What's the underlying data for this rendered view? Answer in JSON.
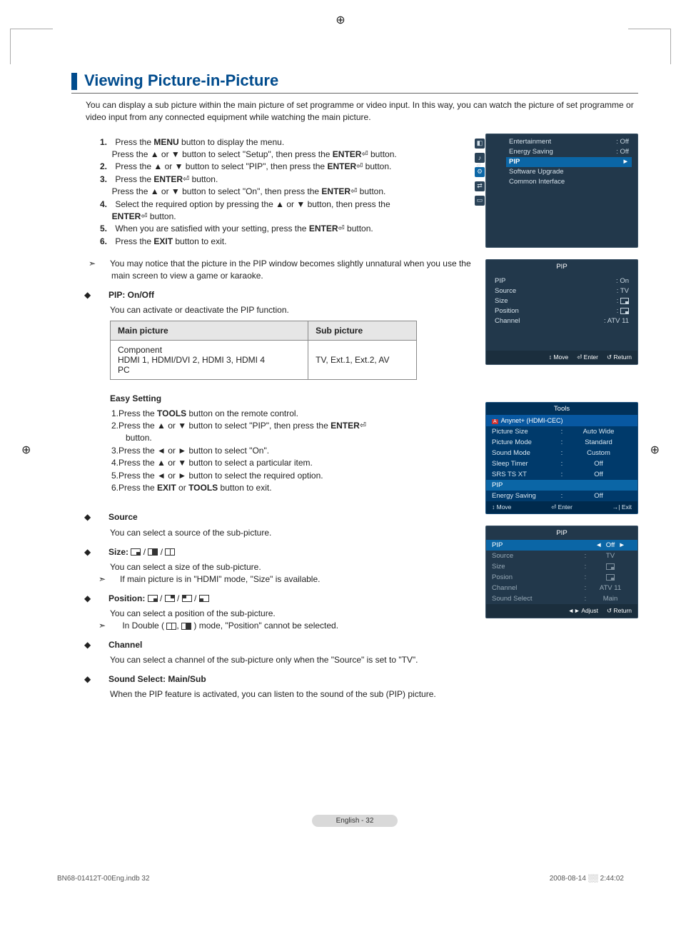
{
  "page": {
    "title": "Viewing Picture-in-Picture",
    "intro": "You can display a sub picture within the main picture of set programme or video input. In this way, you can watch the picture of set programme or video input from any connected equipment while watching the main picture.",
    "page_label": "English - 32",
    "footer_left": "BN68-01412T-00Eng.indb   32",
    "footer_right": "2008-08-14   ░░ 2:44:02"
  },
  "steps": {
    "s1_a": "Press the ",
    "s1_b": "MENU",
    "s1_c": " button to display the menu.",
    "s1_d": "Press the ▲ or ▼ button to select \"Setup\", then press the ",
    "s1_e": "ENTER",
    "s1_f": " button.",
    "s2_a": "Press the ▲ or ▼ button to select \"PIP\", then press the ",
    "s2_b": "ENTER",
    "s2_c": " button.",
    "s3_a": "Press the ",
    "s3_b": "ENTER",
    "s3_c": " button.",
    "s3_d": "Press the ▲ or ▼ button to select \"On\", then press the ",
    "s3_e": "ENTER",
    "s3_f": " button.",
    "s4_a": "Select the required option by pressing the ▲ or ▼ button, then press the ",
    "s4_b": "ENTER",
    "s4_c": " button.",
    "s5_a": "When you are satisfied with your setting, press the ",
    "s5_b": "ENTER",
    "s5_c": " button.",
    "s6_a": "Press the ",
    "s6_b": "EXIT",
    "s6_c": " button to exit.",
    "note": "You may notice that the picture in the PIP window becomes slightly unnatural when you use the main screen to view a game or karaoke."
  },
  "pip_onoff": {
    "label": "PIP: On/Off",
    "desc": "You can activate or deactivate the PIP function."
  },
  "table": {
    "h1": "Main picture",
    "h2": "Sub picture",
    "main_line1": "Component",
    "main_line2": "HDMI 1, HDMI/DVI 2, HDMI 3, HDMI 4",
    "main_line3": "PC",
    "sub": "TV, Ext.1, Ext.2, AV"
  },
  "easy": {
    "title": "Easy Setting",
    "s1_a": "Press the ",
    "s1_b": "TOOLS",
    "s1_c": " button on the remote control.",
    "s2_a": "Press the ▲ or ▼ button to select \"PIP\", then press the ",
    "s2_b": "ENTER",
    "s2_c": " button.",
    "s3": "Press the ◄ or ► button to select \"On\".",
    "s4": "Press the ▲ or ▼ button to select a particular item.",
    "s5": "Press the ◄ or ► button to select the required option.",
    "s6_a": "Press the ",
    "s6_b": "EXIT",
    "s6_c": " or ",
    "s6_d": "TOOLS",
    "s6_e": " button to exit."
  },
  "source": {
    "label": "Source",
    "desc": "You can select a source of the sub-picture."
  },
  "size": {
    "label": "Size:",
    "desc": "You can select a size of the sub-picture.",
    "note": "If main picture is in \"HDMI\" mode, \"Size\" is available."
  },
  "position": {
    "label": "Position:",
    "desc": "You can select a position of the sub-picture.",
    "note_a": "In Double (",
    "note_b": ",",
    "note_c": ") mode, \"Position\" cannot be selected."
  },
  "channel": {
    "label": "Channel",
    "desc": "You can select a channel of the sub-picture only when the \"Source\" is set to \"TV\"."
  },
  "sound": {
    "label": "Sound Select: Main/Sub",
    "desc": "When the PIP feature is activated, you can listen to the sound of the sub (PIP) picture."
  },
  "osd_setup": {
    "side_label": "Setup",
    "rows": [
      {
        "label": "Entertainment",
        "value": ": Off"
      },
      {
        "label": "Energy Saving",
        "value": ": Off"
      },
      {
        "label": "PIP",
        "value": "►",
        "selected": true
      },
      {
        "label": "Software Upgrade",
        "value": ""
      },
      {
        "label": "Common Interface",
        "value": ""
      }
    ]
  },
  "osd_pip": {
    "title": "PIP",
    "rows": [
      {
        "label": "PIP",
        "value": ": On"
      },
      {
        "label": "Source",
        "value": ": TV"
      },
      {
        "label": "Size",
        "value": "icon"
      },
      {
        "label": "Position",
        "value": "icon"
      },
      {
        "label": "Channel",
        "value": ": ATV 11"
      }
    ],
    "footer": {
      "move": "↕ Move",
      "enter": "⏎ Enter",
      "return": "↺ Return"
    }
  },
  "osd_tools": {
    "title": "Tools",
    "header": "Anynet+ (HDMI-CEC)",
    "rows": [
      {
        "label": "Picture Size",
        "value": "Auto Wide"
      },
      {
        "label": "Picture Mode",
        "value": "Standard"
      },
      {
        "label": "Sound Mode",
        "value": "Custom"
      },
      {
        "label": "Sleep Timer",
        "value": "Off"
      },
      {
        "label": "SRS TS XT",
        "value": "Off"
      },
      {
        "label": "PIP",
        "value": "",
        "selected": true
      },
      {
        "label": "Energy Saving",
        "value": "Off"
      }
    ],
    "footer": {
      "move": "↕ Move",
      "enter": "⏎ Enter",
      "exit": "→| Exit"
    }
  },
  "osd_pip2": {
    "title": "PIP",
    "rows": [
      {
        "label": "PIP",
        "value": "Off",
        "selected": true,
        "arrows": true
      },
      {
        "label": "Source",
        "value": "TV"
      },
      {
        "label": "Size",
        "value": "icon"
      },
      {
        "label": "Posion",
        "value": "icon"
      },
      {
        "label": "Channel",
        "value": "ATV 11"
      },
      {
        "label": "Sound Select",
        "value": "Main"
      }
    ],
    "footer": {
      "adjust": "◄► Adjust",
      "return": "↺ Return"
    }
  }
}
